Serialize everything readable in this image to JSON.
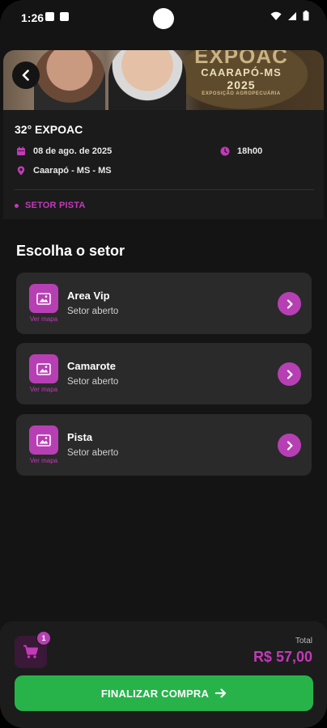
{
  "status_bar": {
    "time": "1:26"
  },
  "hero": {
    "logo_line1": "EXPOAC",
    "logo_line2": "CAARAPÓ-MS",
    "logo_line3": "2025",
    "logo_line4": "EXPOSIÇÃO AGROPECUÁRIA"
  },
  "event": {
    "title": "32° EXPOAC",
    "date": "08 de ago. de 2025",
    "time": "18h00",
    "location": "Caarapó - MS - MS",
    "selected_sector": "SETOR PISTA"
  },
  "sectors_section": {
    "title": "Escolha o setor",
    "view_map_label": "Ver mapa",
    "items": [
      {
        "name": "Area Vip",
        "status": "Setor aberto"
      },
      {
        "name": "Camarote",
        "status": "Setor aberto"
      },
      {
        "name": "Pista",
        "status": "Setor aberto"
      }
    ]
  },
  "footer": {
    "cart_count": "1",
    "total_label": "Total",
    "total_value": "R$ 57,00",
    "finalize_label": "FINALIZAR COMPRA"
  },
  "colors": {
    "accent": "#b73fb4",
    "accent_text": "#c23ab8",
    "success": "#27b34a",
    "background": "#141414",
    "card": "#2a2a2a"
  }
}
